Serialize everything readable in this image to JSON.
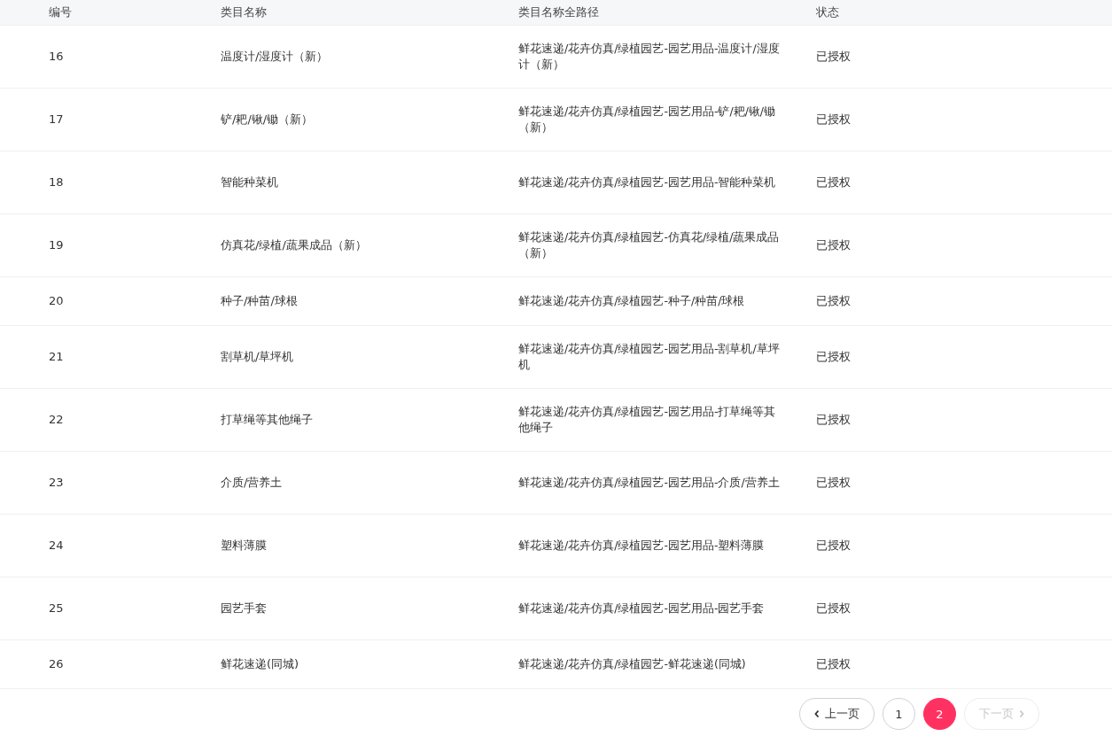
{
  "table": {
    "columns": [
      "编号",
      "类目名称",
      "类目名称全路径",
      "状态"
    ],
    "rows": [
      {
        "id": "16",
        "name": "温度计/湿度计（新）",
        "path": "鲜花速递/花卉仿真/绿植园艺-园艺用品-温度计/湿度计（新）",
        "status": "已授权"
      },
      {
        "id": "17",
        "name": "铲/耙/锹/锄（新）",
        "path": "鲜花速递/花卉仿真/绿植园艺-园艺用品-铲/耙/锹/锄（新）",
        "status": "已授权"
      },
      {
        "id": "18",
        "name": "智能种菜机",
        "path": "鲜花速递/花卉仿真/绿植园艺-园艺用品-智能种菜机",
        "status": "已授权"
      },
      {
        "id": "19",
        "name": "仿真花/绿植/蔬果成品（新）",
        "path": "鲜花速递/花卉仿真/绿植园艺-仿真花/绿植/蔬果成品（新）",
        "status": "已授权"
      },
      {
        "id": "20",
        "name": "种子/种苗/球根",
        "path": "鲜花速递/花卉仿真/绿植园艺-种子/种苗/球根",
        "status": "已授权"
      },
      {
        "id": "21",
        "name": "割草机/草坪机",
        "path": "鲜花速递/花卉仿真/绿植园艺-园艺用品-割草机/草坪机",
        "status": "已授权"
      },
      {
        "id": "22",
        "name": "打草绳等其他绳子",
        "path": "鲜花速递/花卉仿真/绿植园艺-园艺用品-打草绳等其他绳子",
        "status": "已授权"
      },
      {
        "id": "23",
        "name": "介质/营养土",
        "path": "鲜花速递/花卉仿真/绿植园艺-园艺用品-介质/营养土",
        "status": "已授权"
      },
      {
        "id": "24",
        "name": "塑料薄膜",
        "path": "鲜花速递/花卉仿真/绿植园艺-园艺用品-塑料薄膜",
        "status": "已授权"
      },
      {
        "id": "25",
        "name": "园艺手套",
        "path": "鲜花速递/花卉仿真/绿植园艺-园艺用品-园艺手套",
        "status": "已授权"
      },
      {
        "id": "26",
        "name": "鲜花速递(同城)",
        "path": "鲜花速递/花卉仿真/绿植园艺-鲜花速递(同城)",
        "status": "已授权"
      }
    ]
  },
  "pagination": {
    "prev": {
      "label": "上一页",
      "disabled": false
    },
    "pages": [
      {
        "label": "1",
        "selected": false
      },
      {
        "label": "2",
        "selected": true
      }
    ],
    "next": {
      "label": "下一页",
      "disabled": true
    }
  }
}
